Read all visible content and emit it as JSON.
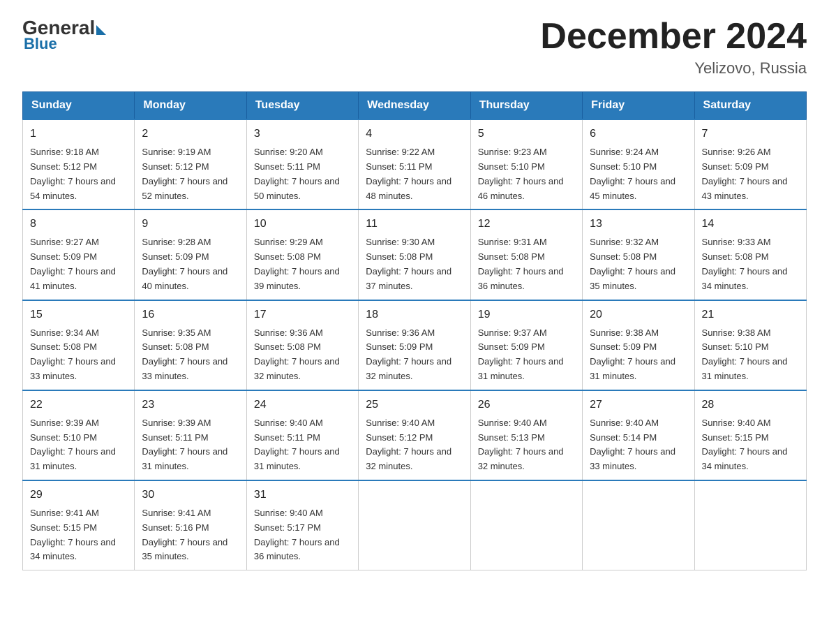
{
  "logo": {
    "general_text": "General",
    "blue_text": "Blue"
  },
  "title": {
    "main": "December 2024",
    "sub": "Yelizovo, Russia"
  },
  "days_of_week": [
    "Sunday",
    "Monday",
    "Tuesday",
    "Wednesday",
    "Thursday",
    "Friday",
    "Saturday"
  ],
  "weeks": [
    [
      {
        "day": "1",
        "sunrise": "9:18 AM",
        "sunset": "5:12 PM",
        "daylight": "7 hours and 54 minutes."
      },
      {
        "day": "2",
        "sunrise": "9:19 AM",
        "sunset": "5:12 PM",
        "daylight": "7 hours and 52 minutes."
      },
      {
        "day": "3",
        "sunrise": "9:20 AM",
        "sunset": "5:11 PM",
        "daylight": "7 hours and 50 minutes."
      },
      {
        "day": "4",
        "sunrise": "9:22 AM",
        "sunset": "5:11 PM",
        "daylight": "7 hours and 48 minutes."
      },
      {
        "day": "5",
        "sunrise": "9:23 AM",
        "sunset": "5:10 PM",
        "daylight": "7 hours and 46 minutes."
      },
      {
        "day": "6",
        "sunrise": "9:24 AM",
        "sunset": "5:10 PM",
        "daylight": "7 hours and 45 minutes."
      },
      {
        "day": "7",
        "sunrise": "9:26 AM",
        "sunset": "5:09 PM",
        "daylight": "7 hours and 43 minutes."
      }
    ],
    [
      {
        "day": "8",
        "sunrise": "9:27 AM",
        "sunset": "5:09 PM",
        "daylight": "7 hours and 41 minutes."
      },
      {
        "day": "9",
        "sunrise": "9:28 AM",
        "sunset": "5:09 PM",
        "daylight": "7 hours and 40 minutes."
      },
      {
        "day": "10",
        "sunrise": "9:29 AM",
        "sunset": "5:08 PM",
        "daylight": "7 hours and 39 minutes."
      },
      {
        "day": "11",
        "sunrise": "9:30 AM",
        "sunset": "5:08 PM",
        "daylight": "7 hours and 37 minutes."
      },
      {
        "day": "12",
        "sunrise": "9:31 AM",
        "sunset": "5:08 PM",
        "daylight": "7 hours and 36 minutes."
      },
      {
        "day": "13",
        "sunrise": "9:32 AM",
        "sunset": "5:08 PM",
        "daylight": "7 hours and 35 minutes."
      },
      {
        "day": "14",
        "sunrise": "9:33 AM",
        "sunset": "5:08 PM",
        "daylight": "7 hours and 34 minutes."
      }
    ],
    [
      {
        "day": "15",
        "sunrise": "9:34 AM",
        "sunset": "5:08 PM",
        "daylight": "7 hours and 33 minutes."
      },
      {
        "day": "16",
        "sunrise": "9:35 AM",
        "sunset": "5:08 PM",
        "daylight": "7 hours and 33 minutes."
      },
      {
        "day": "17",
        "sunrise": "9:36 AM",
        "sunset": "5:08 PM",
        "daylight": "7 hours and 32 minutes."
      },
      {
        "day": "18",
        "sunrise": "9:36 AM",
        "sunset": "5:09 PM",
        "daylight": "7 hours and 32 minutes."
      },
      {
        "day": "19",
        "sunrise": "9:37 AM",
        "sunset": "5:09 PM",
        "daylight": "7 hours and 31 minutes."
      },
      {
        "day": "20",
        "sunrise": "9:38 AM",
        "sunset": "5:09 PM",
        "daylight": "7 hours and 31 minutes."
      },
      {
        "day": "21",
        "sunrise": "9:38 AM",
        "sunset": "5:10 PM",
        "daylight": "7 hours and 31 minutes."
      }
    ],
    [
      {
        "day": "22",
        "sunrise": "9:39 AM",
        "sunset": "5:10 PM",
        "daylight": "7 hours and 31 minutes."
      },
      {
        "day": "23",
        "sunrise": "9:39 AM",
        "sunset": "5:11 PM",
        "daylight": "7 hours and 31 minutes."
      },
      {
        "day": "24",
        "sunrise": "9:40 AM",
        "sunset": "5:11 PM",
        "daylight": "7 hours and 31 minutes."
      },
      {
        "day": "25",
        "sunrise": "9:40 AM",
        "sunset": "5:12 PM",
        "daylight": "7 hours and 32 minutes."
      },
      {
        "day": "26",
        "sunrise": "9:40 AM",
        "sunset": "5:13 PM",
        "daylight": "7 hours and 32 minutes."
      },
      {
        "day": "27",
        "sunrise": "9:40 AM",
        "sunset": "5:14 PM",
        "daylight": "7 hours and 33 minutes."
      },
      {
        "day": "28",
        "sunrise": "9:40 AM",
        "sunset": "5:15 PM",
        "daylight": "7 hours and 34 minutes."
      }
    ],
    [
      {
        "day": "29",
        "sunrise": "9:41 AM",
        "sunset": "5:15 PM",
        "daylight": "7 hours and 34 minutes."
      },
      {
        "day": "30",
        "sunrise": "9:41 AM",
        "sunset": "5:16 PM",
        "daylight": "7 hours and 35 minutes."
      },
      {
        "day": "31",
        "sunrise": "9:40 AM",
        "sunset": "5:17 PM",
        "daylight": "7 hours and 36 minutes."
      },
      null,
      null,
      null,
      null
    ]
  ]
}
